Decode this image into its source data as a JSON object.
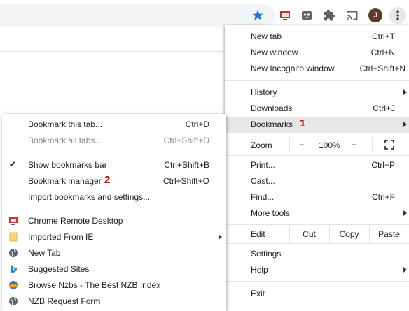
{
  "main_menu": {
    "new_tab": {
      "label": "New tab",
      "shortcut": "Ctrl+T"
    },
    "new_window": {
      "label": "New window",
      "shortcut": "Ctrl+N"
    },
    "new_incognito": {
      "label": "New Incognito window",
      "shortcut": "Ctrl+Shift+N"
    },
    "history": {
      "label": "History"
    },
    "downloads": {
      "label": "Downloads",
      "shortcut": "Ctrl+J"
    },
    "bookmarks": {
      "label": "Bookmarks",
      "step": "1"
    },
    "zoom": {
      "label": "Zoom",
      "minus": "−",
      "value": "100%",
      "plus": "+"
    },
    "print": {
      "label": "Print...",
      "shortcut": "Ctrl+P"
    },
    "cast": {
      "label": "Cast..."
    },
    "find": {
      "label": "Find...",
      "shortcut": "Ctrl+F"
    },
    "more_tools": {
      "label": "More tools"
    },
    "edit": {
      "label": "Edit",
      "cut": "Cut",
      "copy": "Copy",
      "paste": "Paste"
    },
    "settings": {
      "label": "Settings"
    },
    "help": {
      "label": "Help"
    },
    "exit": {
      "label": "Exit"
    }
  },
  "bookmarks_menu": {
    "bookmark_tab": {
      "label": "Bookmark this tab...",
      "shortcut": "Ctrl+D"
    },
    "bookmark_all": {
      "label": "Bookmark all tabs...",
      "shortcut": "Ctrl+Shift+D"
    },
    "show_bar": {
      "label": "Show bookmarks bar",
      "shortcut": "Ctrl+Shift+B",
      "checked": "✔"
    },
    "manager": {
      "label": "Bookmark manager",
      "shortcut": "Ctrl+Shift+O",
      "step": "2"
    },
    "import": {
      "label": "Import bookmarks and settings..."
    },
    "items": [
      {
        "label": "Chrome Remote Desktop",
        "icon": "remote-desktop-icon"
      },
      {
        "label": "Imported From IE",
        "icon": "folder-icon"
      },
      {
        "label": "New Tab",
        "icon": "globe-icon"
      },
      {
        "label": "Suggested Sites",
        "icon": "bing-icon"
      },
      {
        "label": "Browse Nzbs - The Best NZB Index",
        "icon": "nzb-icon"
      },
      {
        "label": "NZB Request Form",
        "icon": "globe-icon"
      }
    ]
  },
  "toolbar": {
    "avatar_initial": "J",
    "icons": [
      "bookmark-star-icon",
      "remote-desktop-icon",
      "robot-extension-icon",
      "extensions-puzzle-icon",
      "cast-icon",
      "menu-dots-icon"
    ]
  },
  "colors": {
    "accent": "#1a73e8",
    "step": "#cc0000",
    "highlight": "#e8e8e8"
  }
}
